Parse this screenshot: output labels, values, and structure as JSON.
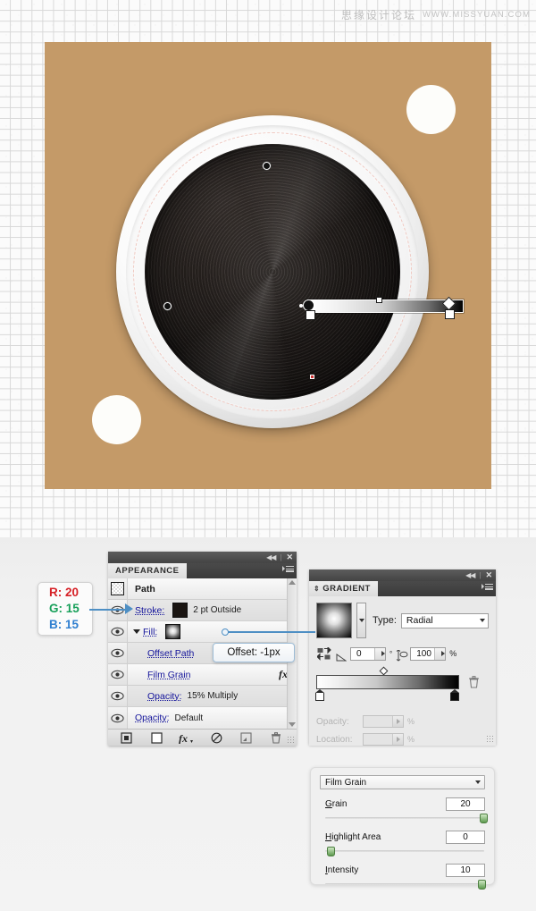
{
  "watermark": {
    "cn": "思缘设计论坛",
    "en": "WWW.MISSYUAN.COM"
  },
  "canvas": {
    "background_color": "#c49a68",
    "record": {
      "vinyl_color": "#1d1917",
      "rim_color": "#f6f6f6",
      "path_dash_color": "#f0c8c0"
    }
  },
  "rgb_callout": {
    "r": "R: 20",
    "g": "G: 15",
    "b": "B: 15"
  },
  "appearance_panel": {
    "tab_label": "APPEARANCE",
    "rows": [
      {
        "label": "Path",
        "value": "",
        "type": "target"
      },
      {
        "label": "Stroke:",
        "value": "2 pt  Outside",
        "type": "stroke"
      },
      {
        "label": "Fill:",
        "value": "",
        "type": "fill"
      },
      {
        "label": "Offset Path",
        "value": "",
        "type": "effect"
      },
      {
        "label": "Film Grain",
        "value": "",
        "type": "effect",
        "fx": "fx"
      },
      {
        "label": "Opacity:",
        "value": "15% Multiply",
        "type": "opacity"
      },
      {
        "label": "Opacity:",
        "value": "Default",
        "type": "opacity"
      }
    ],
    "footer_icons": [
      "add-new-stroke-icon",
      "add-new-fill-icon",
      "add-new-effect-icon",
      "clear-appearance-icon",
      "duplicate-item-icon",
      "delete-item-icon"
    ]
  },
  "gradient_panel": {
    "tab_label": "GRADIENT",
    "type_label": "Type:",
    "type_value": "Radial",
    "angle_value": "0",
    "angle_unit": "°",
    "aspect_value": "100",
    "aspect_unit": "%",
    "opacity_label": "Opacity:",
    "opacity_unit": "%",
    "location_label": "Location:",
    "location_unit": "%",
    "stop_left": {
      "r": "255",
      "g": "255",
      "b": "255"
    },
    "stop_right": {
      "r": "0",
      "g": "0",
      "b": "0"
    }
  },
  "offset_tooltip": {
    "text": "Offset: -1px"
  },
  "film_grain_panel": {
    "effect_name": "Film Grain",
    "sliders": [
      {
        "label": "Grain",
        "underline_char": "G",
        "value": "20",
        "knob_percent": 97
      },
      {
        "label": "Highlight Area",
        "underline_char": "H",
        "value": "0",
        "knob_percent": 2
      },
      {
        "label": "Intensity",
        "underline_char": "I",
        "value": "10",
        "knob_percent": 96
      }
    ]
  }
}
